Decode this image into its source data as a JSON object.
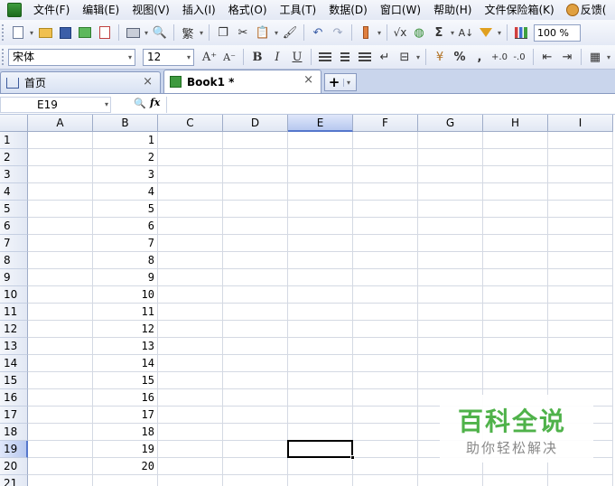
{
  "menubar": {
    "items": [
      "文件(F)",
      "编辑(E)",
      "视图(V)",
      "插入(I)",
      "格式(O)",
      "工具(T)",
      "数据(D)",
      "窗口(W)",
      "帮助(H)",
      "文件保险箱(K)",
      "反馈("
    ]
  },
  "toolbar1": {
    "traditional_label": "繁",
    "sqrt_label": "√x",
    "sigma_label": "Σ",
    "zoom": "100 %"
  },
  "toolbar2": {
    "font_name": "宋体",
    "font_size": "12",
    "grow_label": "A⁺",
    "shrink_label": "A⁻",
    "bold_label": "B",
    "italic_label": "I",
    "underline_label": "U",
    "percent_label": "%",
    "comma_label": ",",
    "inc_decimal_label": "+.0",
    "dec_decimal_label": "-.0"
  },
  "tabs": {
    "home_label": "首页",
    "book_label": "Book1 *",
    "close_glyph": "×",
    "add_glyph": "+",
    "dropdown_glyph": "▾"
  },
  "formula_bar": {
    "name_box": "E19",
    "fx_label": "fx",
    "formula": ""
  },
  "sheet": {
    "columns": [
      "A",
      "B",
      "C",
      "D",
      "E",
      "F",
      "G",
      "H",
      "I"
    ],
    "active_column": "E",
    "rows": [
      "1",
      "2",
      "3",
      "4",
      "5",
      "6",
      "7",
      "8",
      "9",
      "10",
      "11",
      "12",
      "13",
      "14",
      "15",
      "16",
      "17",
      "18",
      "19",
      "20",
      "21"
    ],
    "active_row": "19",
    "column_b_values": [
      "1",
      "2",
      "3",
      "4",
      "5",
      "6",
      "7",
      "8",
      "9",
      "10",
      "11",
      "12",
      "13",
      "14",
      "15",
      "16",
      "17",
      "18",
      "19",
      "20"
    ],
    "selected_cell": "E19"
  },
  "watermark": {
    "title": "百科全说",
    "subtitle": "助你轻松解决"
  }
}
